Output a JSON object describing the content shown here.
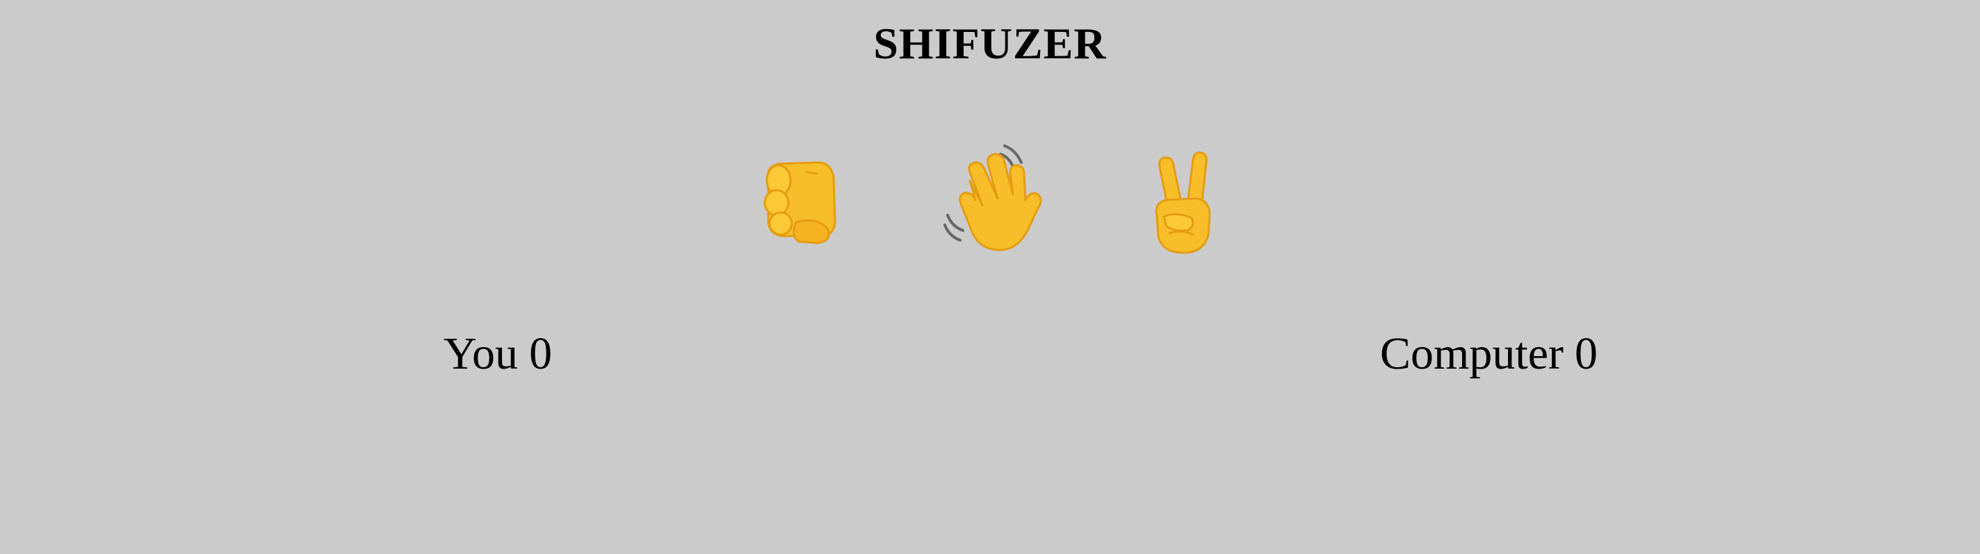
{
  "title": "SHIFUZER",
  "choices": [
    {
      "name": "rock",
      "icon": "oncoming-fist-icon"
    },
    {
      "name": "paper",
      "icon": "waving-hand-icon"
    },
    {
      "name": "scissors",
      "icon": "victory-hand-icon"
    }
  ],
  "score": {
    "player_label": "You",
    "player_value": "0",
    "computer_label": "Computer",
    "computer_value": "0"
  },
  "colors": {
    "background": "#cbcbcb",
    "hand": "#f8be2a",
    "hand_shadow": "#e59c11",
    "text": "#000000"
  }
}
